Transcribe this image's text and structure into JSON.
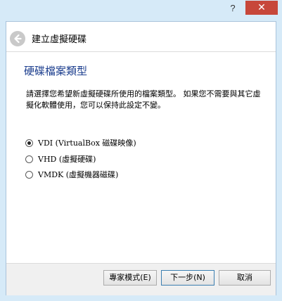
{
  "titlebar": {
    "help_label": "?",
    "close_label": "✕",
    "close_color": "#c7473a"
  },
  "wizard": {
    "title": "建立虛擬硬碟",
    "back_icon": "arrow-left-icon"
  },
  "section": {
    "title": "硬碟檔案類型",
    "description": "請選擇您希望新虛擬硬碟所使用的檔案類型。 如果您不需要與其它虛擬化軟體使用，您可以保持此設定不變。"
  },
  "options": [
    {
      "label": "VDI (VirtualBox 磁碟映像)",
      "checked": true
    },
    {
      "label": "VHD (虛擬硬碟)",
      "checked": false
    },
    {
      "label": "VMDK (虛擬機器磁碟)",
      "checked": false
    }
  ],
  "buttons": {
    "expert": "專家模式(E)",
    "next": "下一步(N)",
    "cancel": "取消"
  },
  "colors": {
    "accent_title": "#1c3e8e",
    "frame": "#d6eaf8"
  }
}
